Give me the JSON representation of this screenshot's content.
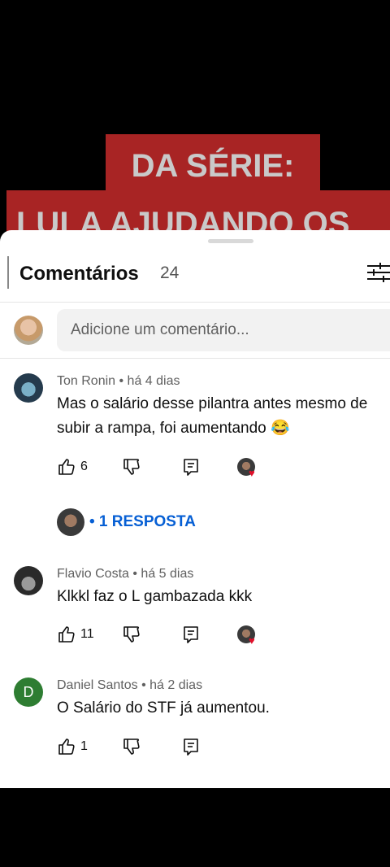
{
  "video": {
    "banner_line1": "DA SÉRIE:",
    "banner_line2": "LULA AJUDANDO OS"
  },
  "header": {
    "title": "Comentários",
    "count": "24"
  },
  "composer": {
    "placeholder": "Adicione um comentário..."
  },
  "comments": [
    {
      "author": "Ton Ronin",
      "time": "há 4 dias",
      "text_line1": "Mas o salário desse pilantra antes mesmo de",
      "text_line2": "subir a rampa, foi aumentando 😂",
      "likes": "6",
      "creator_heart": true,
      "replies_label": "• 1 RESPOSTA"
    },
    {
      "author": "Flavio Costa",
      "time": "há 5 dias",
      "text_line1": "Klkkl faz o L gambazada kkk",
      "likes": "11",
      "creator_heart": true
    },
    {
      "author": "Daniel Santos",
      "time": "há 2 dias",
      "text_line1": "O Salário do STF já aumentou.",
      "likes": "1",
      "avatar_letter": "D",
      "avatar_color": "#2e7d32"
    }
  ],
  "colors": {
    "banner": "#a82424",
    "link": "#065fd4",
    "heart": "#e0102a"
  }
}
